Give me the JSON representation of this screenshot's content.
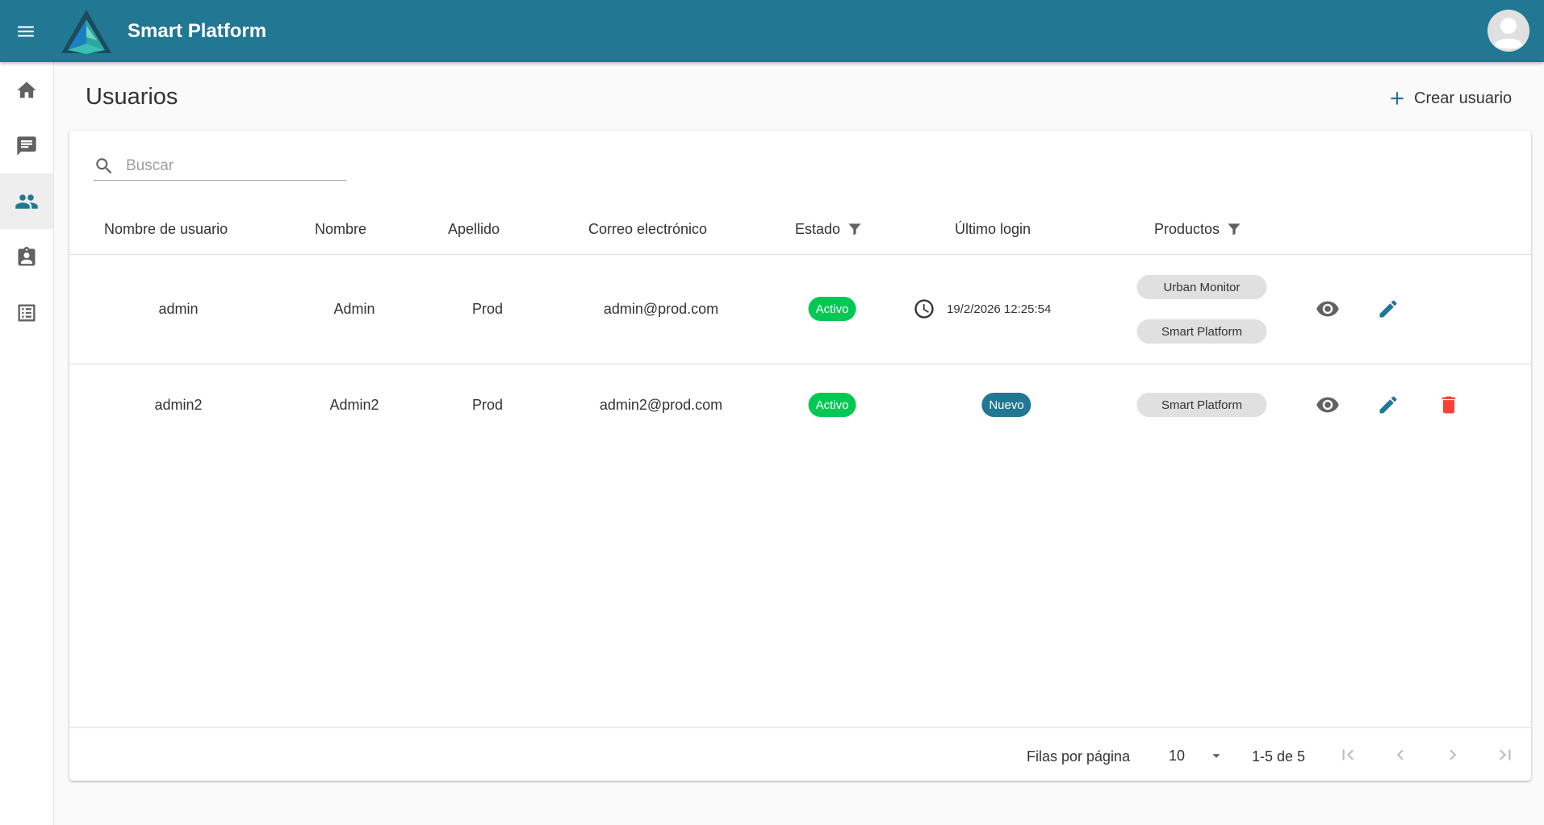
{
  "app": {
    "title": "Smart Platform"
  },
  "header": {
    "icons": {
      "menu": "menu-icon",
      "logo": "pyramid-logo",
      "avatar": "account-icon"
    }
  },
  "sidebar": {
    "items": [
      {
        "name": "home",
        "icon": "home-icon",
        "active": false
      },
      {
        "name": "messages",
        "icon": "message-icon",
        "active": false
      },
      {
        "name": "users",
        "icon": "people-icon",
        "active": true
      },
      {
        "name": "assignments",
        "icon": "clipboard-user-icon",
        "active": false
      },
      {
        "name": "list",
        "icon": "list-icon",
        "active": false
      }
    ]
  },
  "page": {
    "title": "Usuarios",
    "create_label": "Crear usuario"
  },
  "search": {
    "placeholder": "Buscar",
    "value": ""
  },
  "table": {
    "columns": {
      "username": "Nombre de usuario",
      "first_name": "Nombre",
      "last_name": "Apellido",
      "email": "Correo electrónico",
      "status": "Estado",
      "last_login": "Último login",
      "products": "Productos"
    },
    "rows": [
      {
        "username": "admin",
        "first_name": "Admin",
        "last_name": "Prod",
        "email": "admin@prod.com",
        "status": "Activo",
        "last_login": "19/2/2026 12:25:54",
        "products": [
          "Urban Monitor",
          "Smart Platform"
        ]
      },
      {
        "username": "admin2",
        "first_name": "Admin2",
        "last_name": "Prod",
        "email": "admin2@prod.com",
        "status": "Activo",
        "last_login": "Nuevo",
        "products": [
          "Smart Platform"
        ]
      }
    ]
  },
  "pagination": {
    "rows_per_page_label": "Filas por página",
    "rows_per_page": "10",
    "range": "1-5 de 5"
  },
  "colors": {
    "primary": "#227792",
    "active_chip": "#00c853",
    "new_chip": "#227792",
    "delete": "#f44336",
    "icon_grey": "#616161"
  }
}
